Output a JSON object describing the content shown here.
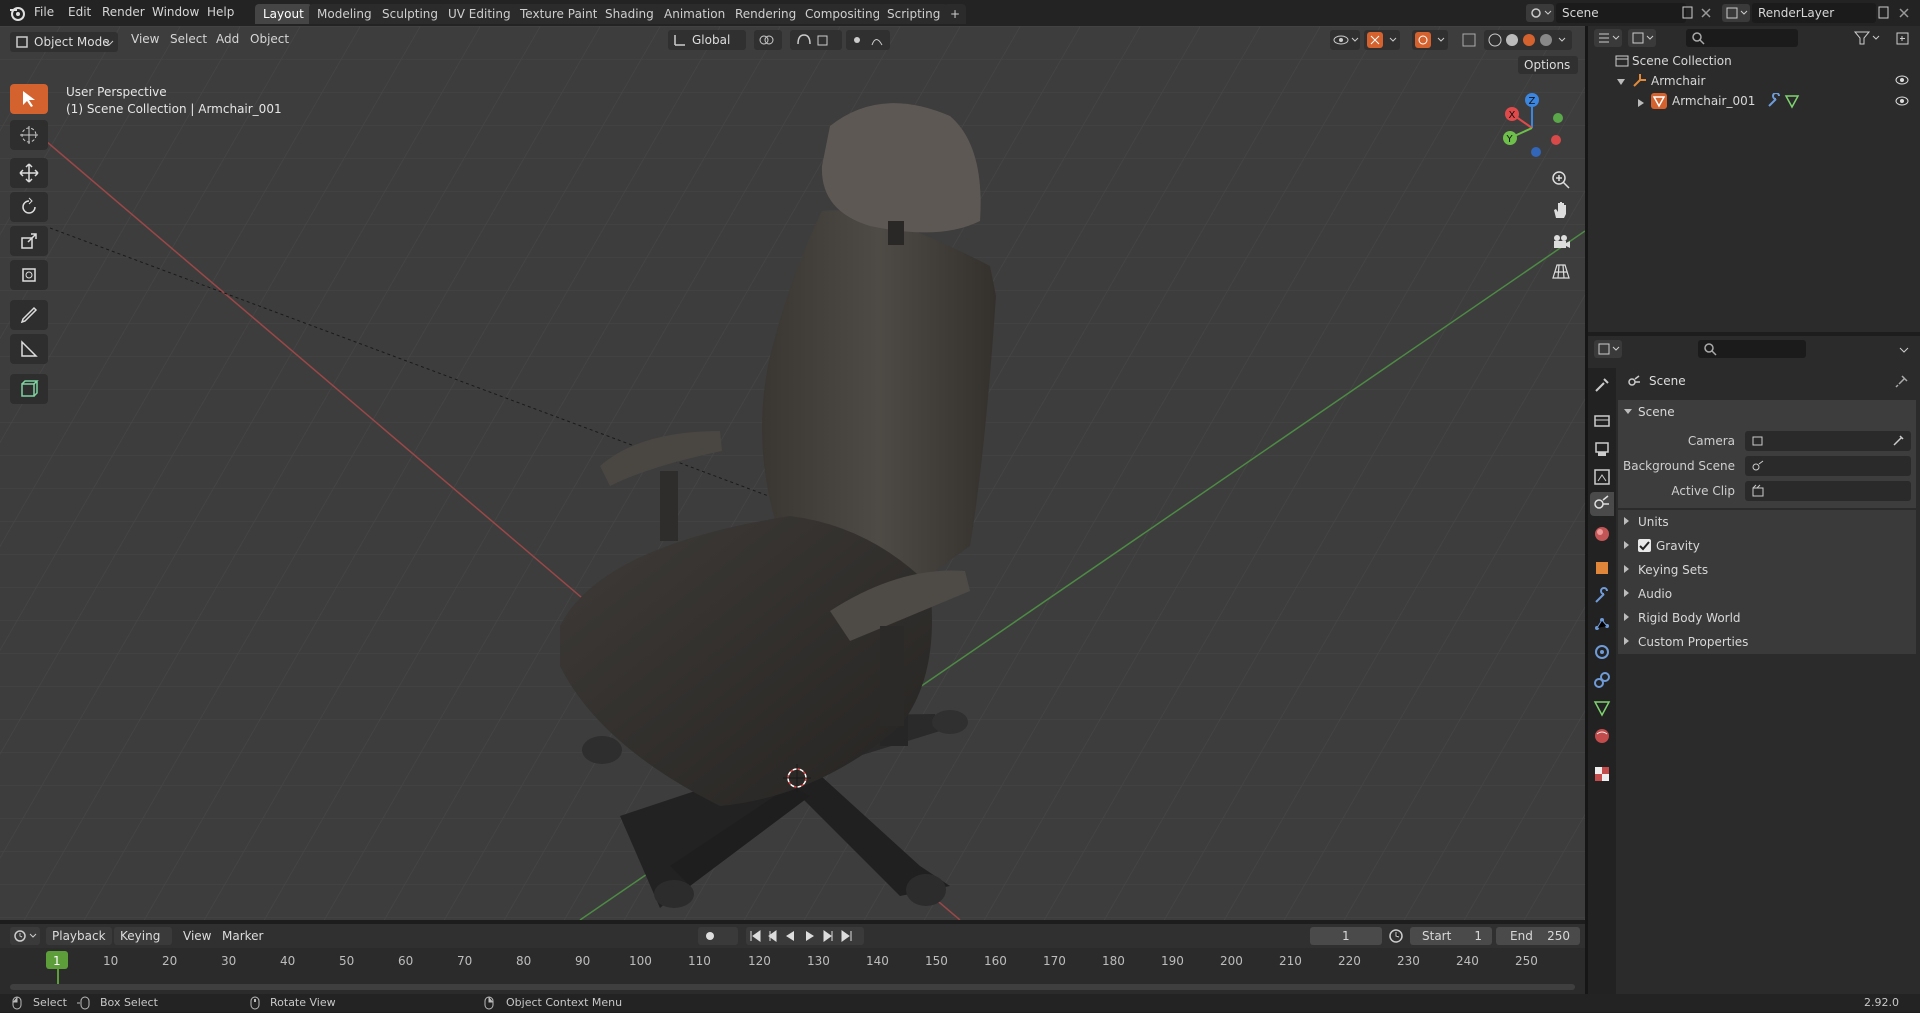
{
  "app": {
    "menu": [
      "File",
      "Edit",
      "Render",
      "Window",
      "Help"
    ],
    "workspaces": [
      "Layout",
      "Modeling",
      "Sculpting",
      "UV Editing",
      "Texture Paint",
      "Shading",
      "Animation",
      "Rendering",
      "Compositing",
      "Scripting"
    ],
    "active_workspace": "Layout",
    "add_workspace": "+",
    "scene_name": "Scene",
    "view_layer": "RenderLayer"
  },
  "viewport": {
    "mode": "Object Mode",
    "menus": [
      "View",
      "Select",
      "Add",
      "Object"
    ],
    "transform_orientation": "Global",
    "options_label": "Options",
    "overlay_title": "User Perspective",
    "overlay_subtitle": "(1) Scene Collection | Armchair_001",
    "gizmo": {
      "x": "X",
      "y": "Y",
      "z": "Z"
    }
  },
  "outliner": {
    "root": "Scene Collection",
    "items": [
      {
        "name": "Armchair",
        "icon": "empty-icon"
      },
      {
        "name": "Armchair_001",
        "icon": "mesh-icon"
      }
    ]
  },
  "properties": {
    "breadcrumb": "Scene",
    "panel_title": "Scene",
    "fields": [
      {
        "label": "Camera"
      },
      {
        "label": "Background Scene"
      },
      {
        "label": "Active Clip"
      }
    ],
    "subpanels": [
      "Units",
      "Gravity",
      "Keying Sets",
      "Audio",
      "Rigid Body World",
      "Custom Properties"
    ],
    "gravity_checked": true
  },
  "timeline": {
    "menus": [
      "Playback",
      "Keying",
      "View",
      "Marker"
    ],
    "current_frame": "1",
    "start_label": "Start",
    "start": "1",
    "end_label": "End",
    "end": "250",
    "ticks": [
      "1",
      "10",
      "20",
      "30",
      "40",
      "50",
      "60",
      "70",
      "80",
      "90",
      "100",
      "110",
      "120",
      "130",
      "140",
      "150",
      "160",
      "170",
      "180",
      "190",
      "200",
      "210",
      "220",
      "230",
      "240",
      "250"
    ]
  },
  "statusbar": {
    "select": "Select",
    "box_select": "Box Select",
    "rotate_view": "Rotate View",
    "context_menu": "Object Context Menu",
    "version": "2.92.0"
  },
  "colors": {
    "accent": "#d3622f",
    "viewport_bg": "#3d3d3d",
    "grid": "#4a4a4a",
    "x_axis": "#c24b4b",
    "y_axis": "#5fa84f",
    "gizmo_x": "#e04a4a",
    "gizmo_y": "#6ec04a",
    "gizmo_z": "#3b86e0"
  }
}
